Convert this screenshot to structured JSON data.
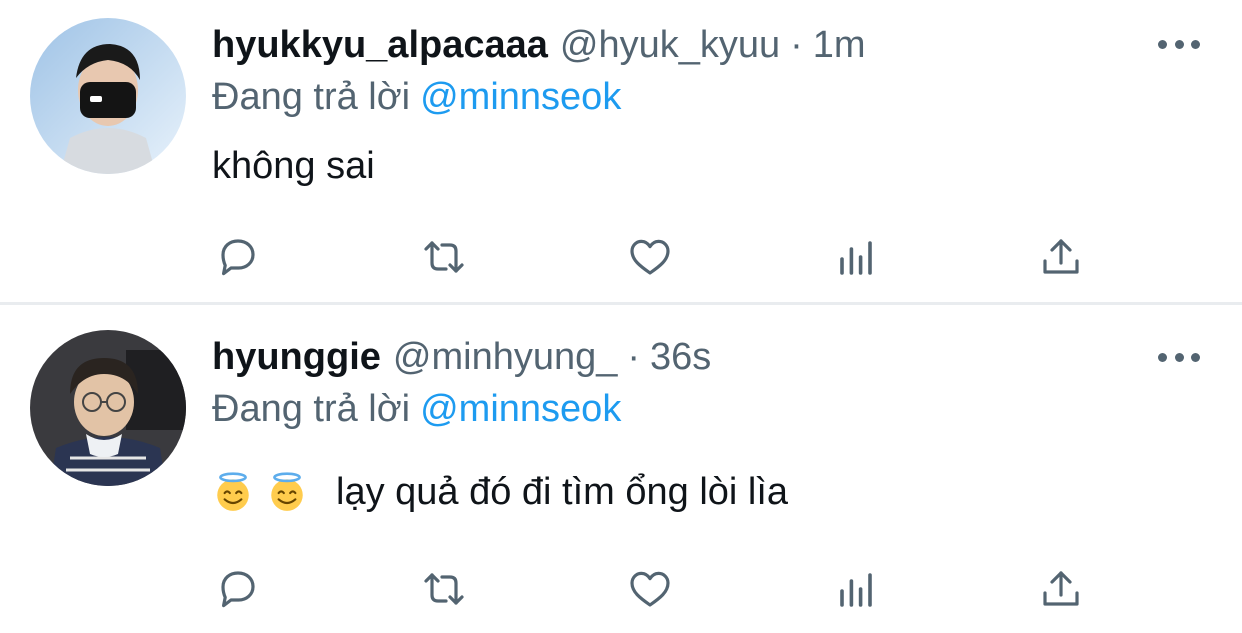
{
  "tweets": [
    {
      "display_name": "hyukkyu_alpacaaa",
      "handle": "@hyuk_kyuu",
      "separator": "·",
      "time": "1m",
      "reply_prefix": "Đang trả lời",
      "reply_to": "@minnseok",
      "text": "không sai",
      "emojis": [],
      "icons": [
        "reply-icon",
        "retweet-icon",
        "like-icon",
        "analytics-icon",
        "share-icon",
        "more-icon"
      ]
    },
    {
      "display_name": "hyunggie",
      "handle": "@minhyung_",
      "separator": "·",
      "time": "36s",
      "reply_prefix": "Đang trả lời",
      "reply_to": "@minnseok",
      "text": "lạy quả đó đi tìm ổng lòi lìa",
      "emojis": [
        "smiling-face-with-halo",
        "smiling-face-with-halo"
      ],
      "icons": [
        "reply-icon",
        "retweet-icon",
        "like-icon",
        "analytics-icon",
        "share-icon",
        "more-icon"
      ]
    }
  ],
  "colors": {
    "text_primary": "#0f1419",
    "text_secondary": "#536471",
    "mention": "#1d9bf0",
    "icon": "#536471",
    "divider": "#e9ecef"
  }
}
